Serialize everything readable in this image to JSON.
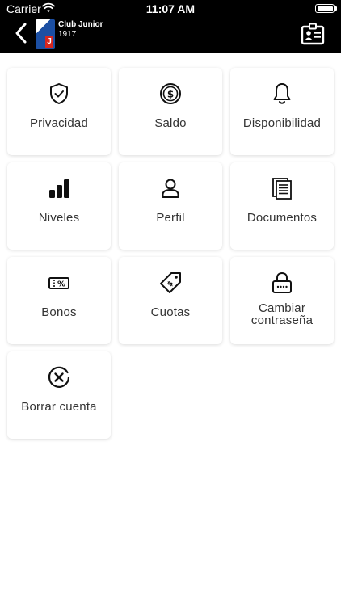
{
  "status_bar": {
    "carrier": "Carrier",
    "time": "11:07 AM"
  },
  "header": {
    "club_name": "Club Junior",
    "club_year": "1917",
    "logo_letter": "J"
  },
  "tiles": [
    {
      "label": "Privacidad",
      "icon": "shield-check-icon"
    },
    {
      "label": "Saldo",
      "icon": "dollar-coin-icon"
    },
    {
      "label": "Disponibilidad",
      "icon": "bell-icon"
    },
    {
      "label": "Niveles",
      "icon": "bar-levels-icon"
    },
    {
      "label": "Perfil",
      "icon": "user-icon"
    },
    {
      "label": "Documentos",
      "icon": "documents-icon"
    },
    {
      "label": "Bonos",
      "icon": "coupon-percent-icon"
    },
    {
      "label": "Cuotas",
      "icon": "price-tag-icon"
    },
    {
      "label": "Cambiar contraseña",
      "icon": "lock-icon"
    },
    {
      "label": "Borrar cuenta",
      "icon": "circle-x-icon"
    }
  ]
}
